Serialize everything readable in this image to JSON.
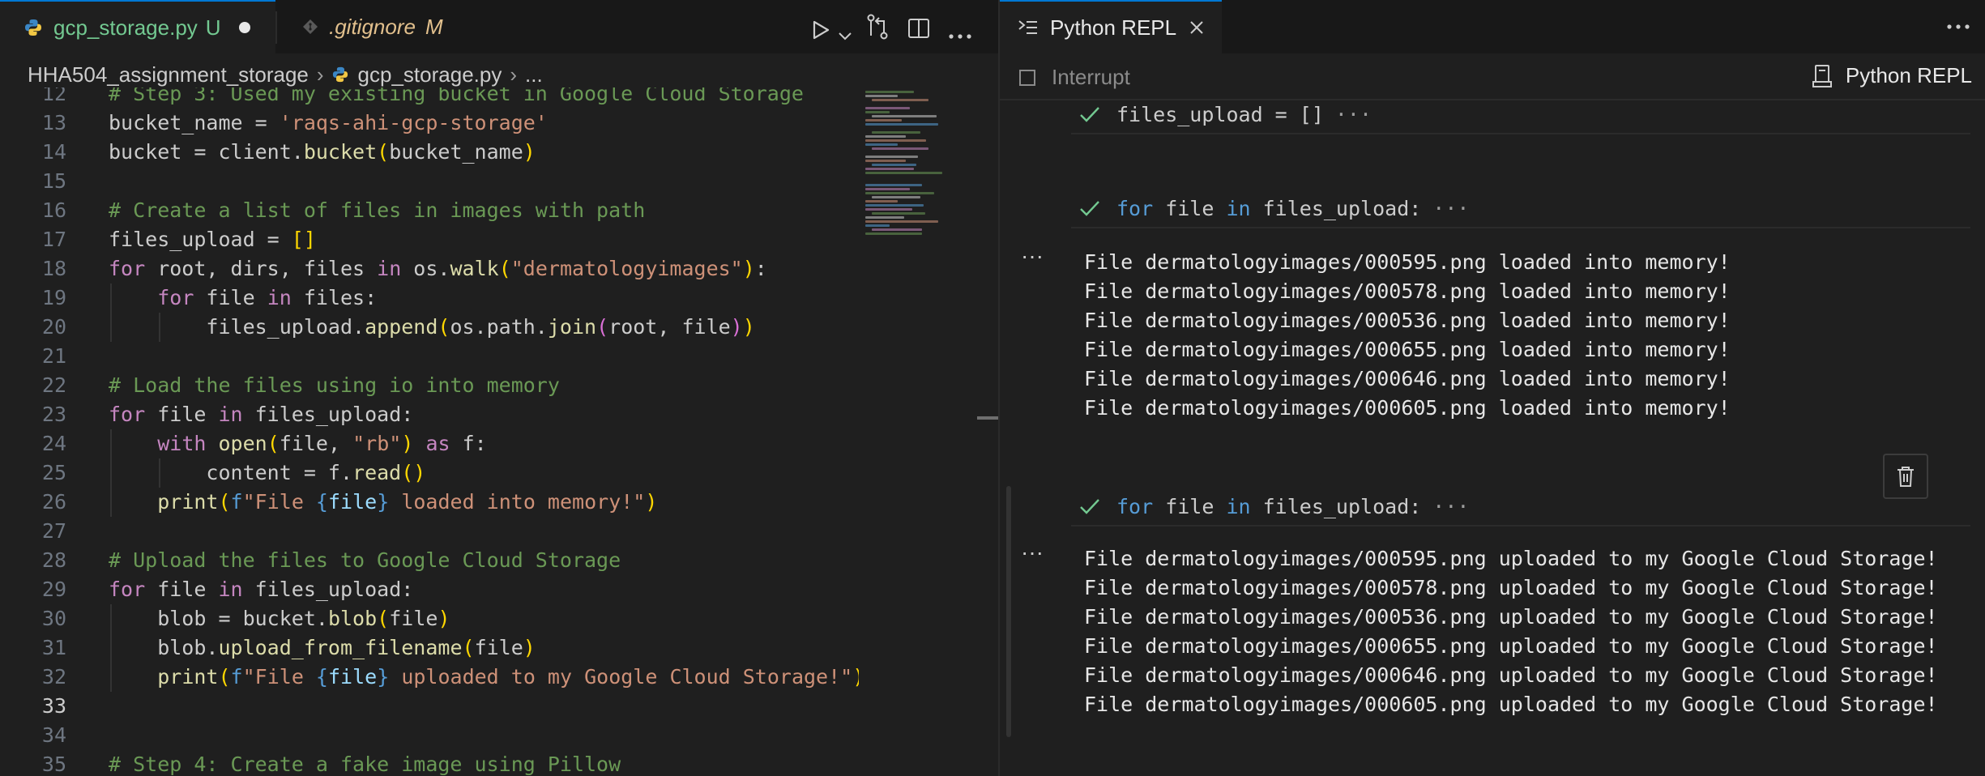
{
  "editor": {
    "tabs": [
      {
        "name": "gcp_storage.py",
        "status": "U",
        "modified": true
      },
      {
        "name": ".gitignore",
        "status": "M"
      }
    ],
    "breadcrumb": {
      "folder": "HHA504_assignment_storage",
      "file": "gcp_storage.py",
      "tail": "..."
    },
    "current_line": "33",
    "lines": [
      {
        "num": "12",
        "segs": [
          {
            "t": "# Step 3: Used my existing bucket in Google Cloud Storage",
            "c": "cmt"
          }
        ]
      },
      {
        "num": "13",
        "segs": [
          {
            "t": "bucket_name = ",
            "c": ""
          },
          {
            "t": "'raqs-ahi-gcp-storage'",
            "c": "str"
          }
        ]
      },
      {
        "num": "14",
        "segs": [
          {
            "t": "bucket = client.",
            "c": ""
          },
          {
            "t": "bucket",
            "c": "fn"
          },
          {
            "t": "(",
            "c": "br1"
          },
          {
            "t": "bucket_name",
            "c": ""
          },
          {
            "t": ")",
            "c": "br1"
          }
        ]
      },
      {
        "num": "15",
        "segs": []
      },
      {
        "num": "16",
        "segs": [
          {
            "t": "# Create a list of files in images with path",
            "c": "cmt"
          }
        ]
      },
      {
        "num": "17",
        "segs": [
          {
            "t": "files_upload = ",
            "c": ""
          },
          {
            "t": "[]",
            "c": "br1"
          }
        ]
      },
      {
        "num": "18",
        "segs": [
          {
            "t": "for",
            "c": "kw2"
          },
          {
            "t": " root, dirs, files ",
            "c": ""
          },
          {
            "t": "in",
            "c": "kw2"
          },
          {
            "t": " os.",
            "c": ""
          },
          {
            "t": "walk",
            "c": "fn"
          },
          {
            "t": "(",
            "c": "br1"
          },
          {
            "t": "\"dermatologyimages\"",
            "c": "str"
          },
          {
            "t": ")",
            "c": "br1"
          },
          {
            "t": ":",
            "c": ""
          }
        ]
      },
      {
        "num": "19",
        "segs": [
          {
            "t": "    ",
            "c": ""
          },
          {
            "t": "for",
            "c": "kw2"
          },
          {
            "t": " file ",
            "c": ""
          },
          {
            "t": "in",
            "c": "kw2"
          },
          {
            "t": " files:",
            "c": ""
          }
        ]
      },
      {
        "num": "20",
        "segs": [
          {
            "t": "        files_upload.",
            "c": ""
          },
          {
            "t": "append",
            "c": "fn"
          },
          {
            "t": "(",
            "c": "br1"
          },
          {
            "t": "os.path.",
            "c": ""
          },
          {
            "t": "join",
            "c": "fn"
          },
          {
            "t": "(",
            "c": "br2"
          },
          {
            "t": "root, file",
            "c": ""
          },
          {
            "t": ")",
            "c": "br2"
          },
          {
            "t": ")",
            "c": "br1"
          }
        ]
      },
      {
        "num": "21",
        "segs": []
      },
      {
        "num": "22",
        "segs": [
          {
            "t": "# Load the files using io into memory",
            "c": "cmt"
          }
        ]
      },
      {
        "num": "23",
        "segs": [
          {
            "t": "for",
            "c": "kw2"
          },
          {
            "t": " file ",
            "c": ""
          },
          {
            "t": "in",
            "c": "kw2"
          },
          {
            "t": " files_upload:",
            "c": ""
          }
        ]
      },
      {
        "num": "24",
        "segs": [
          {
            "t": "    ",
            "c": ""
          },
          {
            "t": "with",
            "c": "kw2"
          },
          {
            "t": " ",
            "c": ""
          },
          {
            "t": "open",
            "c": "fn"
          },
          {
            "t": "(",
            "c": "br1"
          },
          {
            "t": "file, ",
            "c": ""
          },
          {
            "t": "\"rb\"",
            "c": "str"
          },
          {
            "t": ")",
            "c": "br1"
          },
          {
            "t": " ",
            "c": ""
          },
          {
            "t": "as",
            "c": "kw2"
          },
          {
            "t": " f:",
            "c": ""
          }
        ]
      },
      {
        "num": "25",
        "segs": [
          {
            "t": "        content = f.",
            "c": ""
          },
          {
            "t": "read",
            "c": "fn"
          },
          {
            "t": "()",
            "c": "br1"
          }
        ]
      },
      {
        "num": "26",
        "segs": [
          {
            "t": "    ",
            "c": ""
          },
          {
            "t": "print",
            "c": "fn"
          },
          {
            "t": "(",
            "c": "br1"
          },
          {
            "t": "f",
            "c": "kw"
          },
          {
            "t": "\"File ",
            "c": "str"
          },
          {
            "t": "{",
            "c": "kw"
          },
          {
            "t": "file",
            "c": "var"
          },
          {
            "t": "}",
            "c": "kw"
          },
          {
            "t": " loaded into memory!\"",
            "c": "str"
          },
          {
            "t": ")",
            "c": "br1"
          }
        ]
      },
      {
        "num": "27",
        "segs": []
      },
      {
        "num": "28",
        "segs": [
          {
            "t": "# Upload the files to Google Cloud Storage",
            "c": "cmt"
          }
        ]
      },
      {
        "num": "29",
        "segs": [
          {
            "t": "for",
            "c": "kw2"
          },
          {
            "t": " file ",
            "c": ""
          },
          {
            "t": "in",
            "c": "kw2"
          },
          {
            "t": " files_upload:",
            "c": ""
          }
        ]
      },
      {
        "num": "30",
        "segs": [
          {
            "t": "    blob = bucket.",
            "c": ""
          },
          {
            "t": "blob",
            "c": "fn"
          },
          {
            "t": "(",
            "c": "br1"
          },
          {
            "t": "file",
            "c": ""
          },
          {
            "t": ")",
            "c": "br1"
          }
        ]
      },
      {
        "num": "31",
        "segs": [
          {
            "t": "    blob.",
            "c": ""
          },
          {
            "t": "upload_from_filename",
            "c": "fn"
          },
          {
            "t": "(",
            "c": "br1"
          },
          {
            "t": "file",
            "c": ""
          },
          {
            "t": ")",
            "c": "br1"
          }
        ]
      },
      {
        "num": "32",
        "segs": [
          {
            "t": "    ",
            "c": ""
          },
          {
            "t": "print",
            "c": "fn"
          },
          {
            "t": "(",
            "c": "br1"
          },
          {
            "t": "f",
            "c": "kw"
          },
          {
            "t": "\"File ",
            "c": "str"
          },
          {
            "t": "{",
            "c": "kw"
          },
          {
            "t": "file",
            "c": "var"
          },
          {
            "t": "}",
            "c": "kw"
          },
          {
            "t": " uploaded to my Google Cloud Storage!\"",
            "c": "str"
          },
          {
            "t": ")",
            "c": "br1"
          }
        ]
      },
      {
        "num": "33",
        "segs": []
      },
      {
        "num": "34",
        "segs": []
      },
      {
        "num": "35",
        "segs": [
          {
            "t": "# Step 4: Create a fake image using Pillow",
            "c": "cmt"
          }
        ]
      }
    ]
  },
  "repl": {
    "tab_label": "Python REPL",
    "interrupt_label": "Interrupt",
    "kernel_label": "Python REPL",
    "cells": [
      {
        "code": "files_upload = []",
        "more": "···",
        "outputs": []
      },
      {
        "code": "for file in files_upload:",
        "more": "···",
        "outputs": [
          "File dermatologyimages/000595.png loaded into memory!",
          "File dermatologyimages/000578.png loaded into memory!",
          "File dermatologyimages/000536.png loaded into memory!",
          "File dermatologyimages/000655.png loaded into memory!",
          "File dermatologyimages/000646.png loaded into memory!",
          "File dermatologyimages/000605.png loaded into memory!"
        ]
      },
      {
        "code": "for file in files_upload:",
        "more": "···",
        "outputs": [
          "File dermatologyimages/000595.png uploaded to my Google Cloud Storage!",
          "File dermatologyimages/000578.png uploaded to my Google Cloud Storage!",
          "File dermatologyimages/000536.png uploaded to my Google Cloud Storage!",
          "File dermatologyimages/000655.png uploaded to my Google Cloud Storage!",
          "File dermatologyimages/000646.png uploaded to my Google Cloud Storage!",
          "File dermatologyimages/000605.png uploaded to my Google Cloud Storage!"
        ]
      }
    ],
    "output_marker": "···"
  },
  "colors": {
    "accent": "#0078d4",
    "untracked": "#73c991",
    "modified": "#e2c08d",
    "check": "#73c991"
  },
  "icons": [
    "python-file-icon",
    "git-file-icon",
    "run-icon",
    "chevron-down-icon",
    "compare-icon",
    "split-editor-icon",
    "more-icon",
    "repl-icon",
    "close-icon",
    "kernel-icon",
    "check-icon",
    "trash-icon"
  ]
}
